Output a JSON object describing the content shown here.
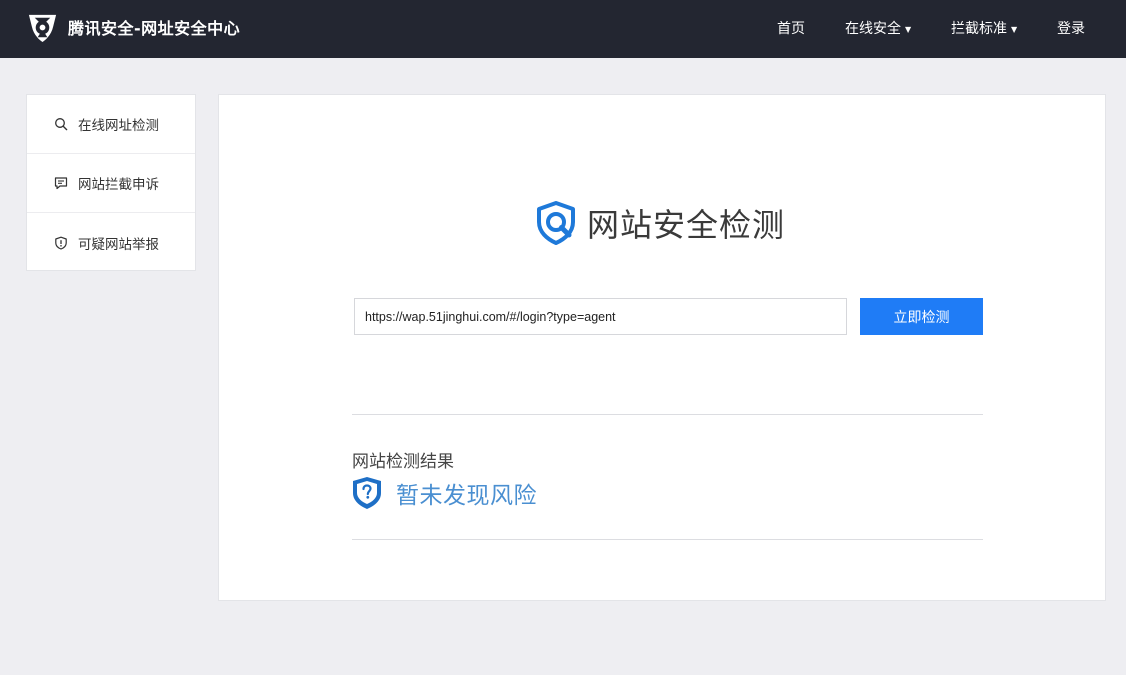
{
  "header": {
    "brand_title": "腾讯安全-网址安全中心",
    "nav": [
      {
        "label": "首页",
        "has_dropdown": false
      },
      {
        "label": "在线安全",
        "has_dropdown": true
      },
      {
        "label": "拦截标准",
        "has_dropdown": true
      },
      {
        "label": "登录",
        "has_dropdown": false
      }
    ],
    "caret": "▼"
  },
  "sidebar": {
    "items": [
      {
        "label": "在线网址检测",
        "icon": "search-icon"
      },
      {
        "label": "网站拦截申诉",
        "icon": "chat-icon"
      },
      {
        "label": "可疑网站举报",
        "icon": "shield-alert-icon"
      }
    ]
  },
  "main": {
    "title": "网站安全检测",
    "url_input": {
      "value": "https://wap.51jinghui.com/#/login?type=agent"
    },
    "check_button_label": "立即检测",
    "result_label": "网站检测结果",
    "result_status": "暂未发现风险"
  },
  "colors": {
    "topbar": "#232631",
    "accent_button": "#1f7cf6",
    "result_text": "#4a8fd1",
    "shield_blue": "#1e79d9"
  }
}
